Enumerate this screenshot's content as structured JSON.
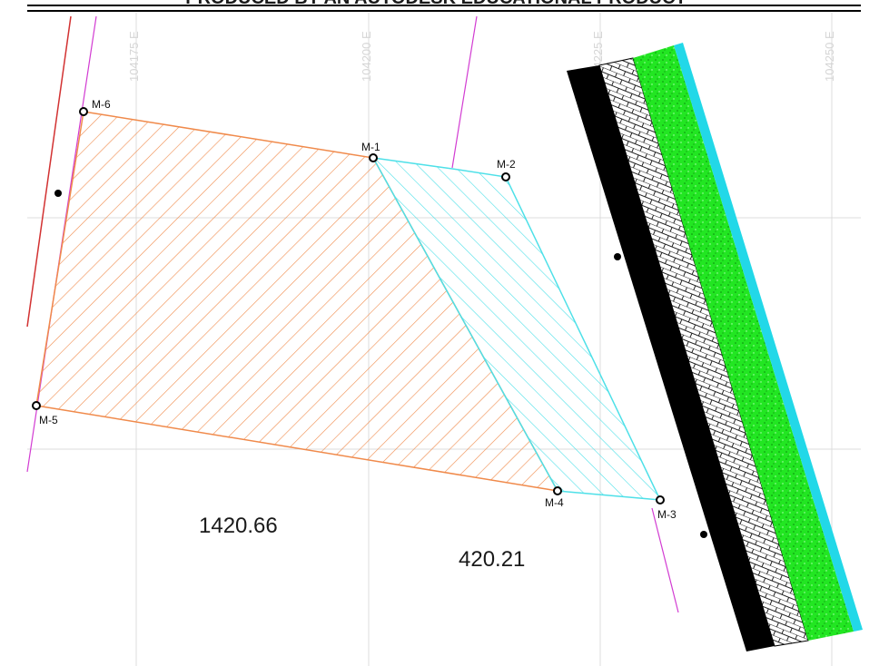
{
  "header": {
    "watermark": "PRODUCED BY AN AUTODESK EDUCATIONAL PRODUCT"
  },
  "grid": {
    "easting_labels": [
      "104175 E",
      "104200 E",
      "104225 E",
      "104250 E"
    ],
    "color": "#dcdcdc"
  },
  "points": [
    {
      "id": "M-1",
      "label": "M-1"
    },
    {
      "id": "M-2",
      "label": "M-2"
    },
    {
      "id": "M-3",
      "label": "M-3"
    },
    {
      "id": "M-4",
      "label": "M-4"
    },
    {
      "id": "M-5",
      "label": "M-5"
    },
    {
      "id": "M-6",
      "label": "M-6"
    }
  ],
  "parcels": [
    {
      "name": "parcel-orange",
      "area": "1420.66",
      "color": "#f08a4b"
    },
    {
      "name": "parcel-cyan",
      "area": "420.21",
      "color": "#4ee0e8"
    }
  ],
  "colors": {
    "boundary_magenta": "#d23cd2",
    "boundary_red": "#d23232",
    "road_black": "#000000",
    "pavement_green": "#22e622",
    "edge_cyan": "#22d8e8"
  }
}
